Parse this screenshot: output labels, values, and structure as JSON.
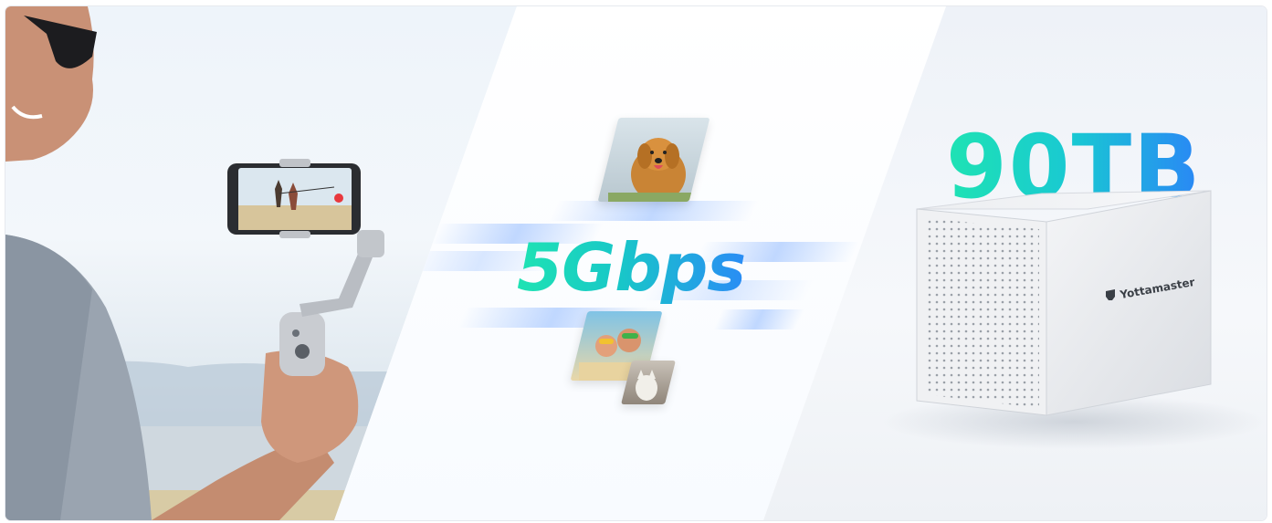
{
  "banner": {
    "speed": "5Gbps",
    "capacity": "90TB",
    "brand": "Yottamaster"
  },
  "colors": {
    "accent_teal": "#1ee3b3",
    "accent_blue": "#2a86f6"
  },
  "icons": {
    "brand_logo": "yottamaster-logo-icon"
  }
}
